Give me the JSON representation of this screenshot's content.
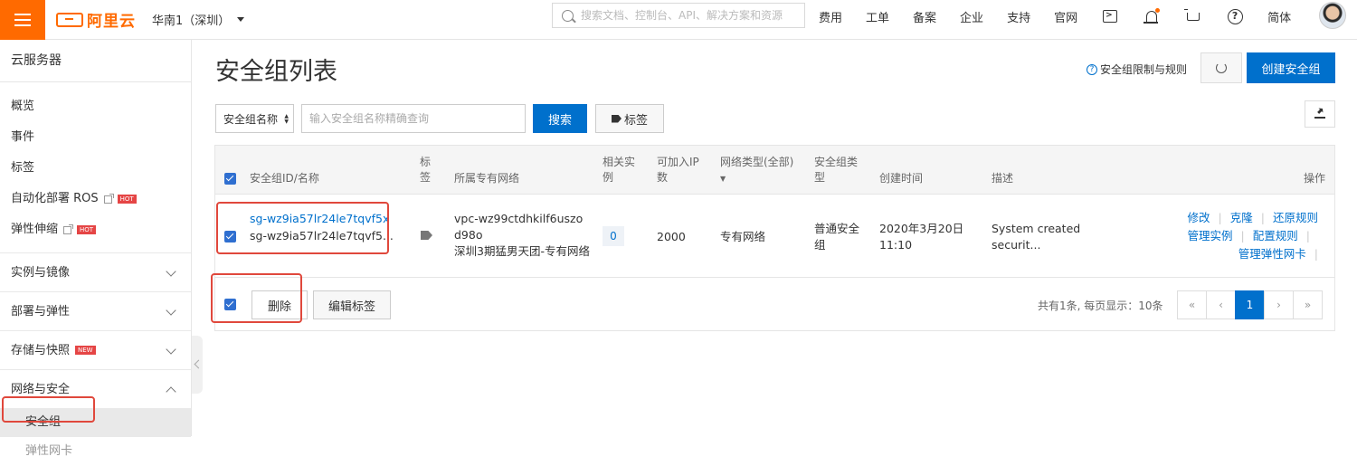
{
  "header": {
    "logo_text": "阿里云",
    "region": "华南1（深圳）",
    "search_placeholder": "搜索文档、控制台、API、解决方案和资源",
    "nav": [
      "费用",
      "工单",
      "备案",
      "企业",
      "支持",
      "官网"
    ],
    "language": "简体",
    "accent_color": "#ff6a00"
  },
  "sidebar": {
    "title": "云服务器",
    "items": [
      {
        "label": "概览"
      },
      {
        "label": "事件"
      },
      {
        "label": "标签"
      },
      {
        "label": "自动化部署 ROS",
        "badge": "HOT"
      },
      {
        "label": "弹性伸缩",
        "badge": "HOT"
      }
    ],
    "groups": [
      {
        "label": "实例与镜像"
      },
      {
        "label": "部署与弹性"
      },
      {
        "label": "存储与快照",
        "badge": "NEW"
      },
      {
        "label": "网络与安全"
      }
    ],
    "active_sub": "安全组",
    "next_sub": "弹性网卡"
  },
  "main": {
    "title": "安全组列表",
    "limit_link": "安全组限制与规则",
    "create_label": "创建安全组",
    "filter_select": "安全组名称",
    "filter_placeholder": "输入安全组名称精确查询",
    "search_label": "搜索",
    "tag_label": "标签"
  },
  "table": {
    "headers": {
      "id": "安全组ID/名称",
      "tag": "标签",
      "vpc": "所属专有网络",
      "instances": "相关实例",
      "ip": "可加入IP数",
      "net_type": "网络类型(全部)",
      "sg_type": "安全组类型",
      "created": "创建时间",
      "desc": "描述",
      "ops": "操作"
    },
    "rows": [
      {
        "id": "sg-wz9ia57lr24le7tqvf5x",
        "name": "sg-wz9ia57lr24le7tqvf5...",
        "vpc_id": "vpc-wz99ctdhkilf6uszod98o",
        "vpc_name": "深圳3期猛男天团-专有网络",
        "instances": "0",
        "ip_count": "2000",
        "net_type": "专有网络",
        "sg_type": "普通安全组",
        "created": "2020年3月20日 11:10",
        "desc": "System created securit...",
        "ops": [
          "修改",
          "克隆",
          "还原规则",
          "管理实例",
          "配置规则",
          "管理弹性网卡"
        ]
      }
    ],
    "footer": {
      "delete_label": "删除",
      "edit_tags_label": "编辑标签",
      "total_text": "共有1条, 每页显示：10条",
      "pager": [
        "«",
        "‹",
        "1",
        "›",
        "»"
      ]
    }
  }
}
